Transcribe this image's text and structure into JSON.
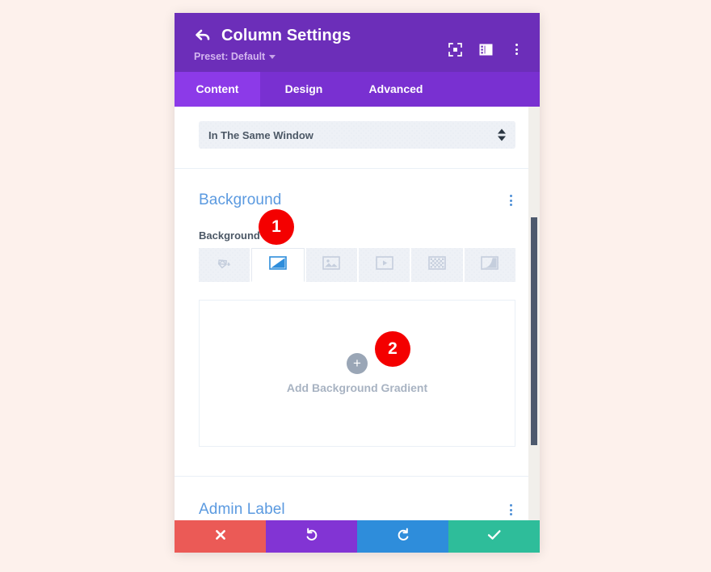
{
  "window": {
    "title": "Column Settings",
    "preset_label": "Preset: Default",
    "back_icon": "back-arrow-icon",
    "header_icons": [
      "focus-frame-icon",
      "layout-panel-icon",
      "overflow-menu-icon"
    ]
  },
  "tabs": [
    {
      "label": "Content",
      "active": true
    },
    {
      "label": "Design",
      "active": false
    },
    {
      "label": "Advanced",
      "active": false
    }
  ],
  "link_target": {
    "value": "In The Same Window"
  },
  "background_section": {
    "title": "Background",
    "field_label": "Background",
    "types": [
      {
        "name": "color-fill-icon",
        "title": "Background Color",
        "active": false
      },
      {
        "name": "gradient-icon",
        "title": "Background Gradient",
        "active": true
      },
      {
        "name": "image-icon",
        "title": "Background Image",
        "active": false
      },
      {
        "name": "video-icon",
        "title": "Background Video",
        "active": false
      },
      {
        "name": "pattern-icon",
        "title": "Background Pattern",
        "active": false
      },
      {
        "name": "mask-icon",
        "title": "Background Mask",
        "active": false
      }
    ],
    "add_gradient_label": "Add Background Gradient",
    "add_icon": "plus-icon"
  },
  "admin_section": {
    "title": "Admin Label"
  },
  "footer": {
    "buttons": [
      {
        "name": "cancel-button",
        "icon": "close-x-icon",
        "color": "#eb5a56"
      },
      {
        "name": "undo-button",
        "icon": "undo-arrow-icon",
        "color": "#8234d4"
      },
      {
        "name": "redo-button",
        "icon": "redo-arrow-icon",
        "color": "#2e8ddb"
      },
      {
        "name": "save-button",
        "icon": "checkmark-icon",
        "color": "#2ebd9a"
      }
    ]
  },
  "step_badges": [
    {
      "number": "1"
    },
    {
      "number": "2"
    }
  ],
  "colors": {
    "header_purple": "#6c2eb9",
    "tabbar_purple": "#7930d1",
    "active_tab_purple": "#8c3ae8",
    "section_title_blue": "#5b9ae0",
    "badge_red": "#f40000",
    "page_background": "#fdf1ec"
  }
}
